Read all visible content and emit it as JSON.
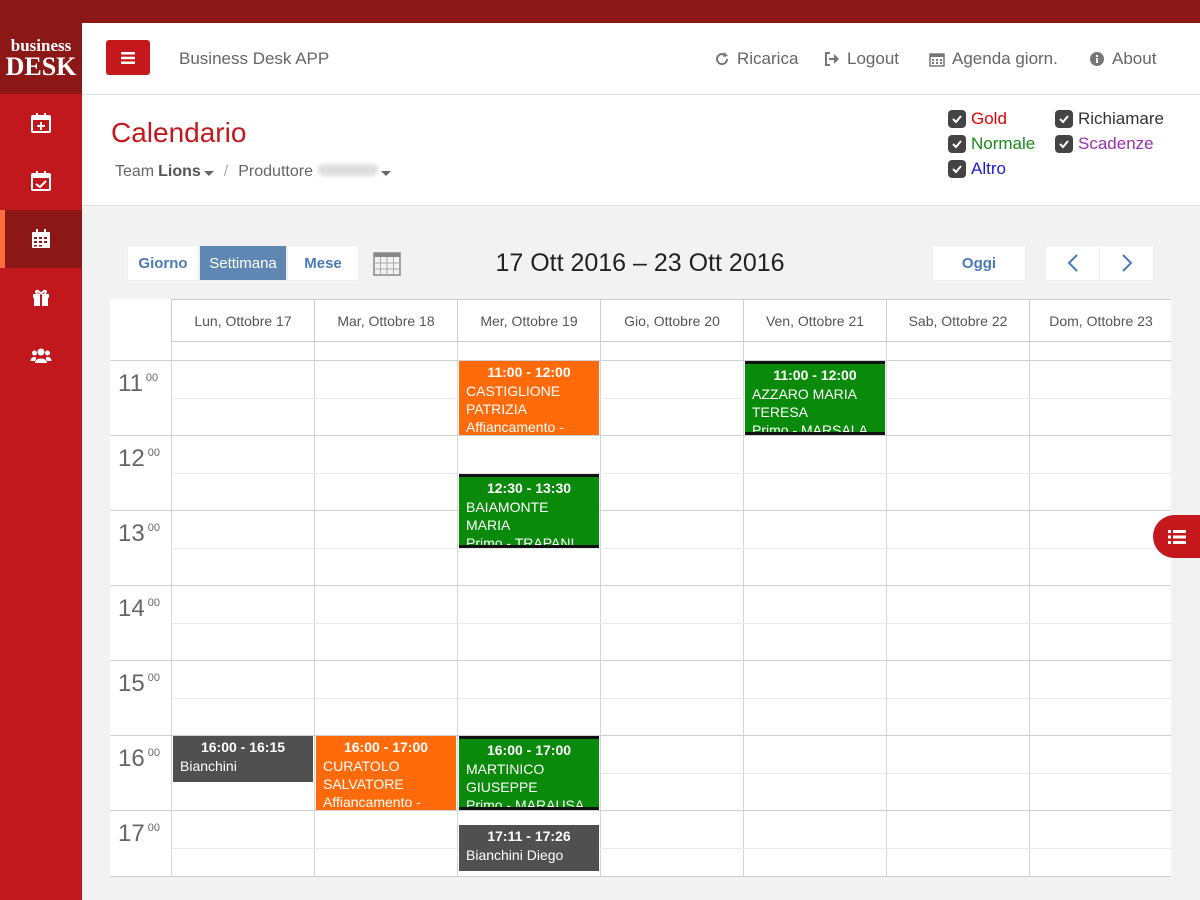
{
  "logo": {
    "line1": "business",
    "line2": "DESK"
  },
  "sidebar": {
    "items": [
      {
        "icon": "calendar-plus-icon"
      },
      {
        "icon": "calendar-check-icon"
      },
      {
        "icon": "calendar-grid-icon",
        "active": true
      },
      {
        "icon": "gift-icon"
      },
      {
        "icon": "users-icon"
      }
    ]
  },
  "header": {
    "app_title": "Business Desk APP",
    "nav": [
      {
        "label": "Ricarica",
        "icon": "refresh-icon"
      },
      {
        "label": "Logout",
        "icon": "logout-icon"
      },
      {
        "label": "Agenda giorn.",
        "icon": "calendar-icon"
      },
      {
        "label": "About",
        "icon": "info-icon"
      }
    ]
  },
  "page": {
    "title": "Calendario",
    "breadcrumb": {
      "team_prefix": "Team",
      "team": "Lions",
      "produttore": "Produttore"
    }
  },
  "legend": [
    {
      "label": "Gold",
      "color": "#e00000",
      "checked": true
    },
    {
      "label": "Richiamare",
      "color": "#333333",
      "checked": true
    },
    {
      "label": "Normale",
      "color": "#1a8a1a",
      "checked": true
    },
    {
      "label": "Scadenze",
      "color": "#9b30b0",
      "checked": true
    },
    {
      "label": "Altro",
      "color": "#1a1ad0",
      "checked": true
    }
  ],
  "toolbar": {
    "views": [
      "Giorno",
      "Settimana",
      "Mese"
    ],
    "active_view": "Settimana",
    "range": "17 Ott 2016 – 23 Ott 2016",
    "today": "Oggi"
  },
  "calendar": {
    "days": [
      "Lun, Ottobre 17",
      "Mar, Ottobre 18",
      "Mer, Ottobre 19",
      "Gio, Ottobre 20",
      "Ven, Ottobre 21",
      "Sab, Ottobre 22",
      "Dom, Ottobre 23"
    ],
    "hours": [
      "11",
      "12",
      "13",
      "14",
      "15",
      "16",
      "17"
    ],
    "minutes_label": "00",
    "events": [
      {
        "day": 2,
        "time": "11:00 - 12:00",
        "lines": [
          "CASTIGLIONE",
          "PATRIZIA",
          "Affiancamento -"
        ],
        "color": "orange"
      },
      {
        "day": 4,
        "time": "11:00 - 12:00",
        "lines": [
          "AZZARO MARIA",
          "TERESA",
          "Primo - MARSALA"
        ],
        "color": "green"
      },
      {
        "day": 2,
        "time": "12:30 - 13:30",
        "lines": [
          "BAIAMONTE",
          "MARIA",
          "Primo - TRAPANI"
        ],
        "color": "green"
      },
      {
        "day": 0,
        "time": "16:00 - 16:15",
        "lines": [
          "Bianchini"
        ],
        "color": "gray"
      },
      {
        "day": 1,
        "time": "16:00 - 17:00",
        "lines": [
          "CURATOLO",
          "SALVATORE",
          "Affiancamento -"
        ],
        "color": "orange"
      },
      {
        "day": 2,
        "time": "16:00 - 17:00",
        "lines": [
          "MARTINICO",
          "GIUSEPPE",
          "Primo - MARAUSA"
        ],
        "color": "green"
      },
      {
        "day": 2,
        "time": "17:11 - 17:26",
        "lines": [
          "Bianchini Diego"
        ],
        "color": "gray"
      }
    ]
  }
}
